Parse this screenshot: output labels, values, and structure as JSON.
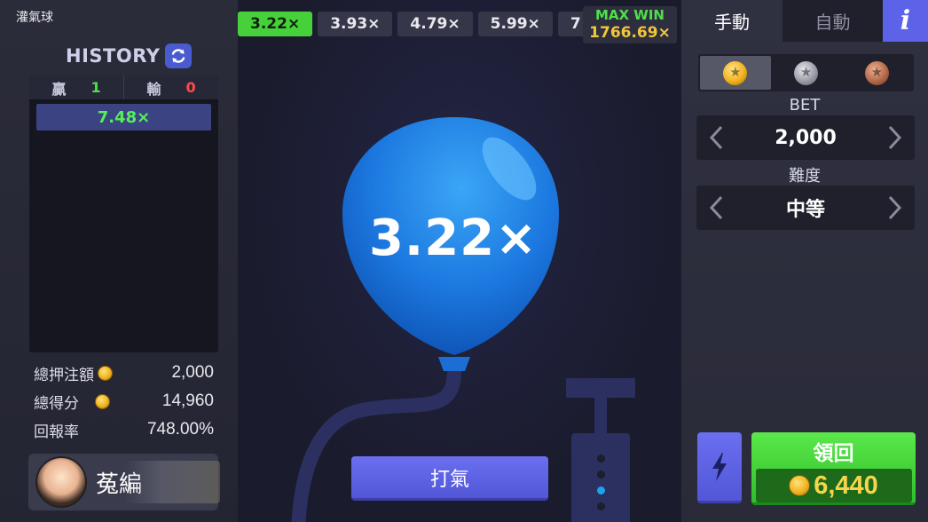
{
  "app": {
    "title": "灌氣球"
  },
  "history": {
    "label": "HISTORY",
    "win_label": "贏",
    "win_count": "1",
    "loss_label": "輸",
    "loss_count": "0",
    "items": [
      "7.48×"
    ]
  },
  "stats": {
    "total_bet_label": "總押注額",
    "total_bet": "2,000",
    "total_win_label": "總得分",
    "total_win": "14,960",
    "rtp_label": "回報率",
    "rtp": "748.00%"
  },
  "user": {
    "name": "菟編"
  },
  "multipliers": [
    "3.22×",
    "3.93×",
    "4.79×",
    "5.99×",
    "7"
  ],
  "max_win": {
    "label": "MAX WIN",
    "value": "1766.69×"
  },
  "balloon": {
    "multiplier": "3.22×",
    "color": "#1f7fe6"
  },
  "pump_button": {
    "label": "打氣"
  },
  "pump_dots": {
    "total": 4,
    "active_index": 2
  },
  "tabs": {
    "manual": "手動",
    "auto": "自動",
    "info": "i"
  },
  "coins": [
    "gold-coin-icon",
    "silver-coin-icon",
    "bronze-coin-icon"
  ],
  "bet": {
    "label": "BET",
    "value": "2,000"
  },
  "difficulty": {
    "label": "難度",
    "value": "中等"
  },
  "collect": {
    "label": "領回",
    "amount": "6,440"
  },
  "colors": {
    "accent": "#5c63e8",
    "win": "#4ee04a",
    "loss": "#ff4a4a",
    "gold": "#f2c63c"
  }
}
